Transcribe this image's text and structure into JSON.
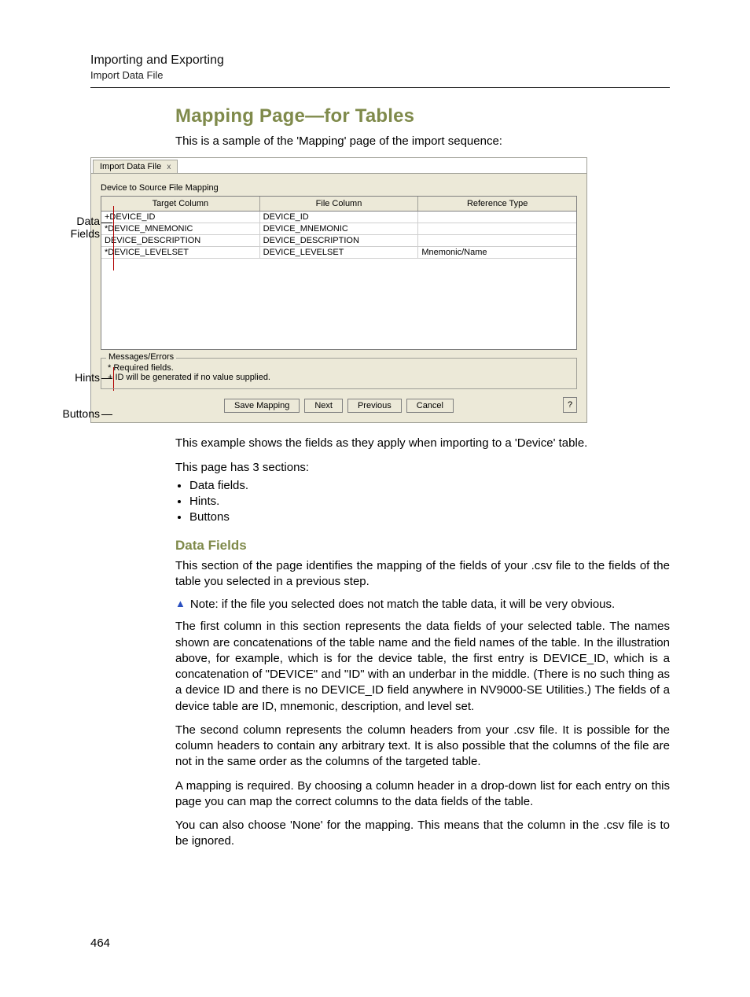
{
  "header": {
    "chapter": "Importing and Exporting",
    "section": "Import Data File"
  },
  "title": "Mapping Page—for Tables",
  "intro": "This is a sample of the 'Mapping' page of the import sequence:",
  "callouts": {
    "data": "Data\nFields",
    "hints": "Hints",
    "buttons": "Buttons"
  },
  "shot": {
    "tab": {
      "label": "Import Data File",
      "close": "x"
    },
    "panel_label": "Device to Source File Mapping",
    "headers": {
      "target": "Target Column",
      "file": "File Column",
      "ref": "Reference Type"
    },
    "rows": [
      {
        "target": "+DEVICE_ID",
        "file": "DEVICE_ID",
        "ref": ""
      },
      {
        "target": "*DEVICE_MNEMONIC",
        "file": "DEVICE_MNEMONIC",
        "ref": ""
      },
      {
        "target": "DEVICE_DESCRIPTION",
        "file": "DEVICE_DESCRIPTION",
        "ref": ""
      },
      {
        "target": "*DEVICE_LEVELSET",
        "file": "DEVICE_LEVELSET",
        "ref": "Mnemonic/Name"
      }
    ],
    "groupbox_title": "Messages/Errors",
    "hints": {
      "line1": "* Required fields.",
      "line2": "+ ID will be generated if no value supplied."
    },
    "buttons": {
      "save": "Save Mapping",
      "next": "Next",
      "prev": "Previous",
      "cancel": "Cancel",
      "help": "?"
    }
  },
  "para_after_fig": "This example shows the fields as they apply when importing to a 'Device' table.",
  "sections_intro": "This page has 3 sections:",
  "sections_list": {
    "a": "Data fields.",
    "b": "Hints.",
    "c": "Buttons"
  },
  "subhead": "Data Fields",
  "df_intro": "This section of the page identifies the mapping of the fields of your .csv file to the fields of the table you selected in a previous step.",
  "note": "Note: if the file you selected does not match the table data, it will be very obvious.",
  "df_p1": "The first column in this section represents the data fields of your selected table. The names shown are concatenations of the table name and the field names of the table. In the illustration above, for example, which is for the device table, the first entry is DEVICE_ID, which is a concatenation of \"DEVICE\" and \"ID\" with an underbar in the middle. (There is no such thing as a device ID and there is no DEVICE_ID field anywhere in NV9000-SE Utilities.) The fields of a device table are ID, mnemonic, description, and level set.",
  "df_p2": "The second column represents the column headers from your .csv file. It is possible for the column headers to contain any arbitrary text. It is also possible that the columns of the file are not in the same order as the columns of the targeted table.",
  "df_p3": "A mapping is required. By choosing a column header in a drop-down list for each entry on this page you can map the correct columns to the data fields of the table.",
  "df_p4": "You can also choose 'None' for the mapping. This means that the column in the .csv file is to be ignored.",
  "page_number": "464"
}
